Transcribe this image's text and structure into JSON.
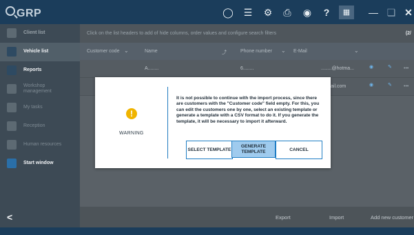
{
  "app": {
    "title": "GRP"
  },
  "topbar": {
    "icons": [
      "globe-icon",
      "list-icon",
      "gear-icon",
      "printer-icon",
      "camera-icon",
      "help-icon",
      "grid-icon",
      "minimize-icon",
      "restore-icon",
      "close-icon"
    ],
    "help_glyph": "?"
  },
  "sidebar": {
    "items": [
      {
        "label": "Client list",
        "state": "faded-top"
      },
      {
        "label": "Vehicle list",
        "state": "selected"
      },
      {
        "label": "Reports",
        "state": "normal"
      },
      {
        "label": "Workshop management",
        "state": "faded"
      },
      {
        "label": "My tasks",
        "state": "faded"
      },
      {
        "label": "Reception",
        "state": "faded"
      },
      {
        "label": "Human resources",
        "state": "faded"
      },
      {
        "label": "Start window",
        "state": "normal"
      }
    ],
    "back_glyph": "<"
  },
  "main": {
    "hint": "Click on the list headers to add of hide columns, order values and configure search filters",
    "page_indicator": "(2/",
    "columns": [
      "Customer code",
      "Name",
      "Phone number",
      "E-Mail"
    ],
    "rows": [
      {
        "name": "A........",
        "phone": "6........",
        "email": "........@hotma..."
      },
      {
        "name": "",
        "phone": "",
        "email": "ail.com"
      }
    ]
  },
  "bottom": {
    "export": "Export",
    "import": "Import",
    "add": "Add new customer"
  },
  "dialog": {
    "warning_label": "WARNING",
    "warning_glyph": "!",
    "message": "It is not possible to continue with the import process, since there are customers with the \"Customer code\" field empty. For this, you can edit the customers one by one, select an existing template or generate a template with a CSV format to do it. If you generate the template, it will be necessary to import it afterward.",
    "buttons": {
      "select_template": "SELECT TEMPLATE",
      "generate_template": "GENERATE TEMPLATE",
      "cancel": "CANCEL"
    }
  },
  "colors": {
    "topbar": "#1b3d5b",
    "accent": "#1e7dc4",
    "warning": "#f0b400",
    "primary_button": "#9fcbee"
  }
}
